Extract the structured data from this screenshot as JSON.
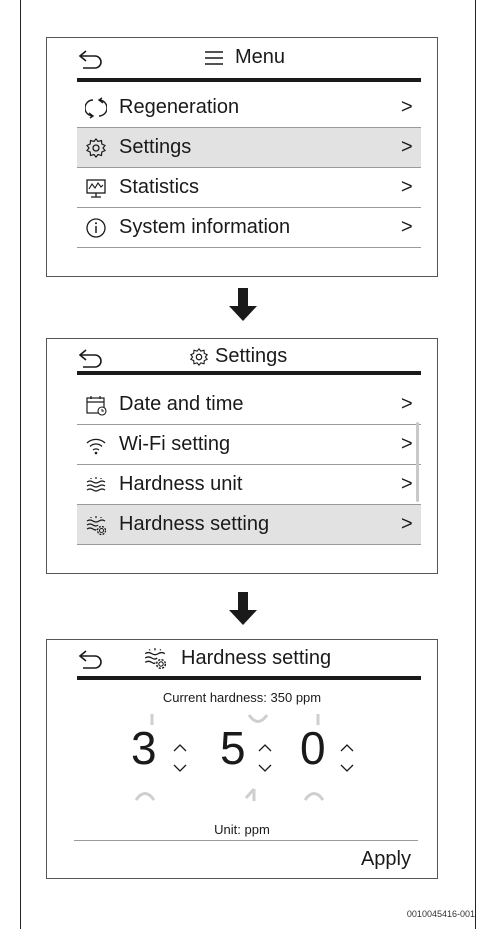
{
  "menu_screen": {
    "title": "Menu",
    "items": [
      {
        "label": "Regeneration",
        "icon": "regeneration-icon",
        "chevron": ">"
      },
      {
        "label": "Settings",
        "icon": "gear-icon",
        "chevron": ">",
        "selected": true
      },
      {
        "label": "Statistics",
        "icon": "statistics-icon",
        "chevron": ">"
      },
      {
        "label": "System information",
        "icon": "info-icon",
        "chevron": ">"
      }
    ]
  },
  "settings_screen": {
    "title": "Settings",
    "items": [
      {
        "label": "Date and time",
        "icon": "calendar-clock-icon",
        "chevron": ">"
      },
      {
        "label": "Wi-Fi setting",
        "icon": "wifi-icon",
        "chevron": ">"
      },
      {
        "label": "Hardness unit",
        "icon": "hardness-icon",
        "chevron": ">"
      },
      {
        "label": "Hardness setting",
        "icon": "hardness-gear-icon",
        "chevron": ">",
        "selected": true
      }
    ]
  },
  "hardness_screen": {
    "title": "Hardness setting",
    "current_hardness": "Current hardness: 350 ppm",
    "digits": [
      "3",
      "5",
      "0"
    ],
    "unit": "Unit: ppm",
    "apply_label": "Apply"
  },
  "document_id": "0010045416-001",
  "colors": {
    "selected_row": "#e2e2e2",
    "rule": "#1a1a1a",
    "border": "#555555"
  }
}
